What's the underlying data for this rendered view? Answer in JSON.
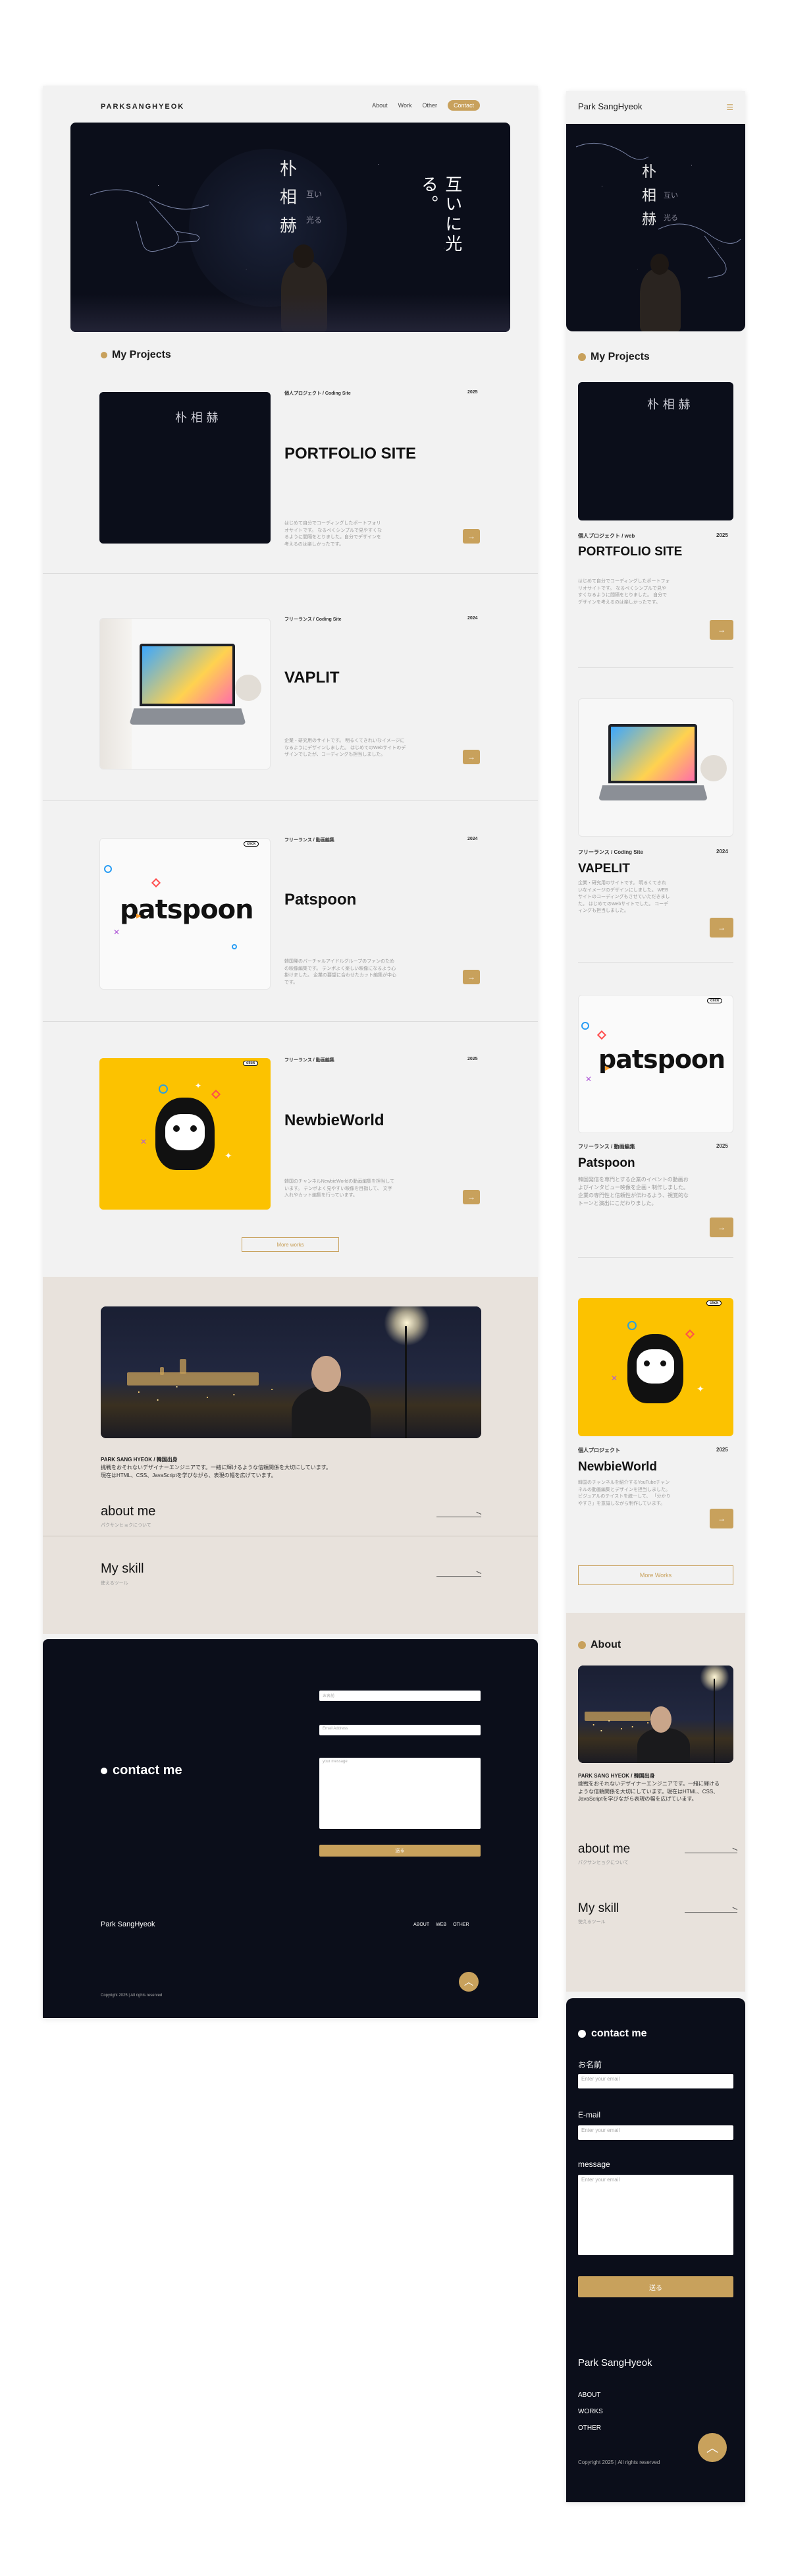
{
  "desktop": {
    "nav": {
      "logo": "PARKSANGHYEOK",
      "links": [
        "About",
        "Work",
        "Other"
      ],
      "contact": "Contact"
    },
    "hero": {
      "name_chars": [
        "朴",
        "相",
        "赫"
      ],
      "sub_chars": [
        "互い",
        "光る"
      ],
      "tagline": "互いに光る。"
    },
    "projects_title": "My Projects",
    "projects": [
      {
        "category": "個人プロジェクト / Coding Site",
        "year": "2025",
        "title": "PORTFOLIO SITE",
        "desc": "はじめて自分でコーディングしたポートフォリオサイトです。 なるべくシンプルで見やすくなるように間隔をとりました。自分でデザインを考えるのは楽しかったです。"
      },
      {
        "category": "フリーランス / Coding Site",
        "year": "2024",
        "title": "VAPLIT",
        "desc": "企業・研究用のサイトです。 明るくてきれいなイメージになるようにデザインしました。 はじめてのWebサイトのデザインでしたが、コーディングも担当しました。"
      },
      {
        "category": "フリーランス / 動画編集",
        "year": "2024",
        "title": "Patspoon",
        "desc": "韓国発のバーチャルアイドルグループのファンのための映像編集です。 テンポよく楽しい映像になるよう心掛けました。 企業の要望に合わせたカット編集が中心です。"
      },
      {
        "category": "フリーランス / 動画編集",
        "year": "2025",
        "title": "NewbieWorld",
        "desc": "韓国のチャンネルNewbieWorldの動画編集を担当しています。 テンポよく見やすい映像を目指して、 文字入れやカット編集を行っています。"
      }
    ],
    "more_works": "More works",
    "about": {
      "name": "PARK SANG HYEOK / 韓国出身",
      "text_1": "挑戦をおそれないデザイナーエンジニアです。一緒に輝けるような信頼関係を大切にしています。",
      "text_2": "現在はHTML、CSS、JavaScriptを学びながら、表現の幅を広げています。",
      "link_1_title": "about me",
      "link_1_sub": "パクサンヒョクについて",
      "link_2_title": "My skill",
      "link_2_sub": "使えるツール"
    },
    "contact": {
      "title": "contact me",
      "name_placeholder": "お名前",
      "email_placeholder": "Email Address",
      "message_placeholder": "your message",
      "submit": "送る",
      "footer_name": "Park SangHyeok",
      "footer_links": [
        "ABOUT",
        "WEB",
        "OTHER"
      ],
      "copyright": "Copyright 2025 | All rights reserved"
    }
  },
  "mobile": {
    "nav_name": "Park SangHyeok",
    "projects_title": "My Projects",
    "projects": [
      {
        "category": "個人プロジェクト / web",
        "year": "2025",
        "title": "PORTFOLIO SITE",
        "desc": "はじめて自分でコーディングしたポートフォリオサイトです。 なるべくシンプルで見やすくなるように間隔をとりました。 自分でデザインを考えるのは楽しかったです。"
      },
      {
        "category": "フリーランス / Coding Site",
        "year": "2024",
        "title": "VAPELIT",
        "desc": "企業・研究用のサイトです。 明るくてきれいなイメージのデザインにしました。 WEBサイトのコーディングもさせていただきました。 はじめてのWebサイトでした。 コーディングも担当しました。"
      },
      {
        "category": "フリーランス / 動画編集",
        "year": "2025",
        "title": "Patspoon",
        "desc": "韓国発信を専門とする企業のイベントの動画およびインタビュー映像を企画・制作しました。 企業の専門性と信頼性が伝わるよう、視覚的なトーンと演出にこだわりました。"
      },
      {
        "category": "個人プロジェクト",
        "year": "2025",
        "title": "NewbieWorld",
        "desc": "韓国のチャンネルを紹介するYouTubeチャンネルの動画編集とデザインを担当しました。 ビジュアルのテイストを統一して、 「分かりやすさ」を意識しながら制作しています。"
      }
    ],
    "more_works": "More Works",
    "about": {
      "title": "About",
      "name": "PARK SANG HYEOK / 韓国出身",
      "text": "挑戦をおそれないデザイナーエンジニアです。一緒に輝けるような信頼関係を大切にしています。現在はHTML、CSS、JavaScriptを学びながら表現の幅を広げています。",
      "link_1_title": "about me",
      "link_1_sub": "パクサンヒョクについて",
      "link_2_title": "My skill",
      "link_2_sub": "使えるツール"
    },
    "contact": {
      "title": "contact me",
      "label_name": "お名前",
      "placeholder_name": "Enter your email",
      "label_email": "E-mail",
      "placeholder_email": "Enter your email",
      "label_message": "message",
      "placeholder_message": "Enter your email",
      "submit": "送る",
      "footer_name": "Park SangHyeok",
      "footer_links": [
        "ABOUT",
        "WORKS",
        "OTHER"
      ],
      "copyright": "Copyright 2025 | All rights reserved"
    }
  },
  "thumb_text": {
    "patspoon": "patspoon",
    "click": "click"
  },
  "colors": {
    "accent": "#c8a15c",
    "navy": "#0b0e1a",
    "beige": "#e8e2dc",
    "yellow": "#fcc200"
  }
}
